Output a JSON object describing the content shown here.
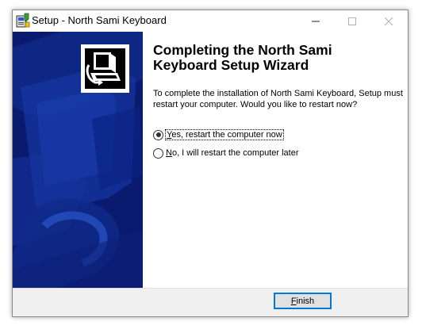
{
  "window": {
    "title": "Setup - North Sami Keyboard"
  },
  "wizard": {
    "heading": "Completing the North Sami Keyboard Setup Wizard",
    "body": "To complete the installation of North Sami Keyboard, Setup must restart your computer. Would you like to restart now?",
    "options": [
      {
        "mnemonic": "Y",
        "rest": "es, restart the computer now",
        "selected": true
      },
      {
        "mnemonic": "N",
        "rest": "o, I will restart the computer later",
        "selected": false
      }
    ],
    "finish": {
      "mnemonic": "F",
      "rest": "inish"
    }
  },
  "icons": {
    "title": "setup-app-icon",
    "minimize": "minimize-icon",
    "maximize": "maximize-icon",
    "close": "close-icon",
    "logo": "computer-install-icon"
  },
  "colors": {
    "sidebar": "#0a1a6e",
    "accent": "#0078d7",
    "footer": "#f0f0f0"
  }
}
